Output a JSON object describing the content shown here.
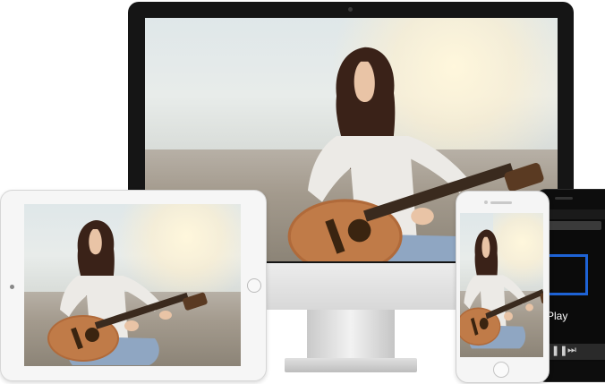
{
  "scene_description_icons": {
    "apple_logo": "apple-logo-icon",
    "home_button": "home-button-icon",
    "pause": "pause-icon",
    "next": "next-icon"
  },
  "phone_app": {
    "label_fragment": "Play",
    "pause_glyph": "❚❚",
    "next_glyph": "⏭"
  },
  "brand": {
    "apple_glyph": ""
  },
  "colors": {
    "imac_bezel": "#151515",
    "accent_blue": "#1e63d6",
    "device_white": "#f5f5f5"
  }
}
